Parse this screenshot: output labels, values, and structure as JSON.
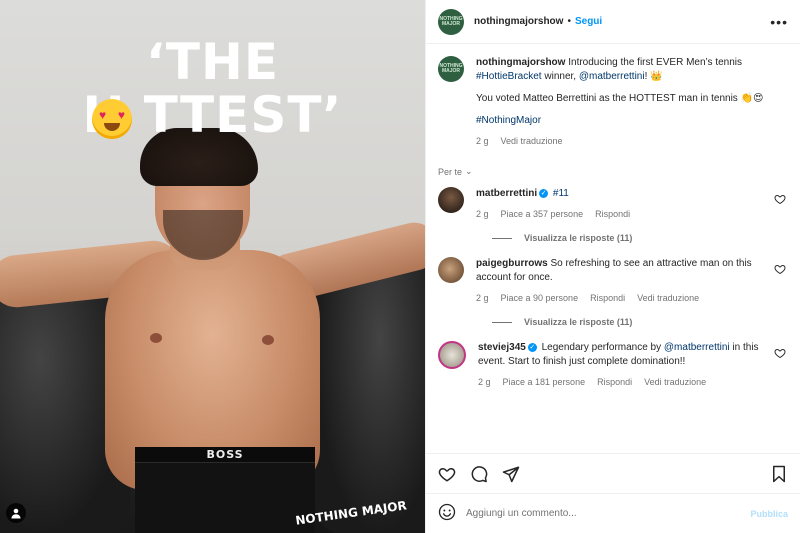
{
  "photo": {
    "headline_line1": "‘THE",
    "headline_line2": "H      TTEST’",
    "shorts_brand": "BOSS",
    "corner_logo": "NOTHING MAJOR"
  },
  "post": {
    "account": "nothingmajorshow",
    "separator": "•",
    "follow_label": "Segui",
    "avatar_text": "NOTHING MAJOR",
    "caption_user": "nothingmajorshow",
    "caption_text": " Introducing the first EVER Men’s tennis ",
    "caption_hashtag": "#HottieBracket",
    "caption_mid": " winner, ",
    "caption_mention": "@matberrettini",
    "caption_end": "! 👑",
    "caption_line2": "You voted Matteo Berrettini as the HOTTEST man in tennis 👏😍",
    "caption_hashtag2": "#NothingMajor",
    "caption_age": "2 g",
    "caption_translate": "Vedi traduzione",
    "for_you": "Per te",
    "chevron": "⌄"
  },
  "comments": [
    {
      "user": "matberrettini",
      "verified": true,
      "text": "#11",
      "age": "2 g",
      "likes": "Piace a 357 persone",
      "reply": "Rispondi",
      "replies": "Visualizza le risposte (11)"
    },
    {
      "user": "paigegburrows",
      "verified": false,
      "text": " So refreshing to see an attractive man on this account for once.",
      "age": "2 g",
      "likes": "Piace a 90 persone",
      "reply": "Rispondi",
      "translate": "Vedi traduzione",
      "replies": "Visualizza le risposte (11)"
    },
    {
      "user": "steviej345",
      "verified": true,
      "text_before": " Legendary performance by ",
      "mention": "@matberrettini",
      "text_after": " in this event. Start to finish just complete domination!!",
      "age": "2 g",
      "likes": "Piace a 181 persone",
      "reply": "Rispondi",
      "translate": "Vedi traduzione"
    }
  ],
  "composer": {
    "placeholder": "Aggiungi un commento...",
    "publish": "Pubblica"
  },
  "colors": {
    "accent": "#0095f6",
    "brand_green": "#2e5f40",
    "link": "#00376b"
  }
}
